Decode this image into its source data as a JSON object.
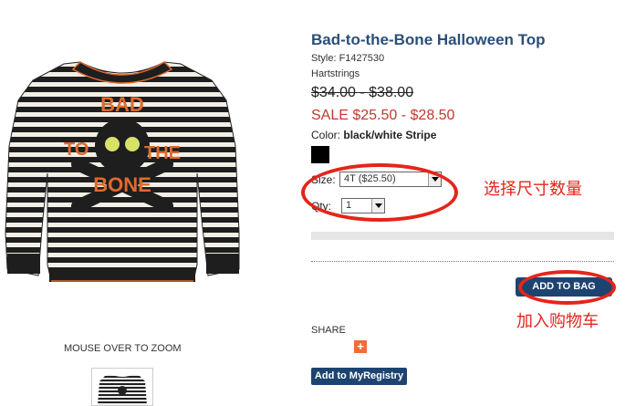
{
  "product": {
    "title": "Bad-to-the-Bone Halloween Top",
    "style": "Style: F1427530",
    "brand": "Hartstrings",
    "original_price": "$34.00 - $38.00",
    "sale_price": "SALE $25.50 - $28.50",
    "color_label": "Color:",
    "color_value": "black/white Stripe",
    "color_swatch": "#000000",
    "print_text": [
      "BAD",
      "TO",
      "THE",
      "BONE"
    ]
  },
  "options": {
    "size_label": "Size:",
    "size_value": "4T ($25.50)",
    "qty_label": "Qty:",
    "qty_value": "1"
  },
  "actions": {
    "add_to_bag": "ADD TO BAG",
    "share_label": "SHARE",
    "share_icon": "plus-icon",
    "registry": "Add to MyRegistry"
  },
  "image": {
    "zoom_hint": "MOUSE OVER TO ZOOM"
  },
  "annotations": {
    "size_note": "选择尺寸数量",
    "bag_note": "加入购物车",
    "color": "#e4251b"
  }
}
